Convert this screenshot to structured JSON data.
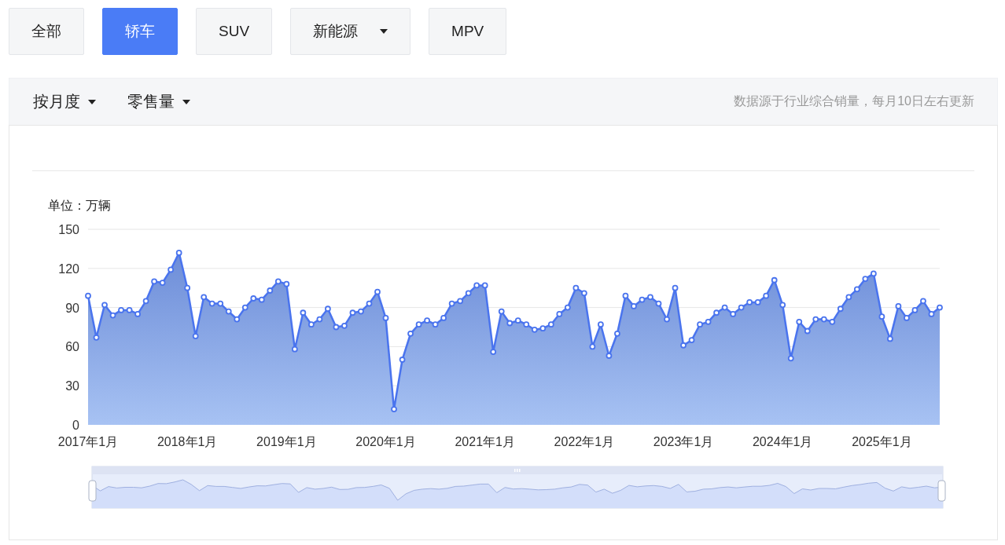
{
  "tabs": [
    {
      "label": "全部",
      "selected": false,
      "has_menu": false
    },
    {
      "label": "轿车",
      "selected": true,
      "has_menu": false
    },
    {
      "label": "SUV",
      "selected": false,
      "has_menu": false
    },
    {
      "label": "新能源",
      "selected": false,
      "has_menu": true
    },
    {
      "label": "MPV",
      "selected": false,
      "has_menu": false
    }
  ],
  "toolbar": {
    "period": "按月度",
    "metric": "零售量",
    "note": "数据源于行业综合销量，每月10日左右更新"
  },
  "chart": {
    "chart_data": {
      "type": "area",
      "ylabel": "单位：万辆",
      "ylim": [
        0,
        150
      ],
      "grid": true,
      "yticks": [
        0,
        30,
        60,
        90,
        120,
        150
      ],
      "categories": [
        "2017年1月",
        null,
        null,
        null,
        null,
        null,
        null,
        null,
        null,
        null,
        null,
        null,
        "2018年1月",
        null,
        null,
        null,
        null,
        null,
        null,
        null,
        null,
        null,
        null,
        null,
        "2019年1月",
        null,
        null,
        null,
        null,
        null,
        null,
        null,
        null,
        null,
        null,
        null,
        "2020年1月",
        null,
        null,
        null,
        null,
        null,
        null,
        null,
        null,
        null,
        null,
        null,
        "2021年1月",
        null,
        null,
        null,
        null,
        null,
        null,
        null,
        null,
        null,
        null,
        null,
        "2022年1月",
        null,
        null,
        null,
        null,
        null,
        null,
        null,
        null,
        null,
        null,
        null,
        "2023年1月",
        null,
        null,
        null,
        null,
        null,
        null,
        null,
        null,
        null,
        null,
        null,
        "2024年1月",
        null,
        null,
        null,
        null,
        null,
        null,
        null,
        null,
        null,
        null,
        null,
        "2025年1月",
        null,
        null,
        null,
        null,
        null,
        null,
        null
      ],
      "series": [
        {
          "color": "#4a74ee",
          "values": [
            99,
            67,
            92,
            84,
            88,
            88,
            85,
            95,
            110,
            109,
            119,
            132,
            105,
            68,
            98,
            93,
            93,
            87,
            81,
            90,
            97,
            96,
            103,
            110,
            108,
            58,
            86,
            77,
            81,
            89,
            75,
            76,
            86,
            87,
            93,
            102,
            82,
            12,
            50,
            70,
            77,
            80,
            77,
            82,
            93,
            95,
            101,
            107,
            107,
            56,
            87,
            78,
            80,
            77,
            73,
            74,
            77,
            85,
            90,
            105,
            101,
            60,
            77,
            53,
            70,
            99,
            91,
            96,
            98,
            93,
            81,
            105,
            61,
            65,
            77,
            79,
            86,
            90,
            85,
            90,
            94,
            94,
            99,
            111,
            92,
            51,
            79,
            72,
            81,
            81,
            79,
            89,
            98,
            104,
            112,
            116,
            83,
            66,
            91,
            82,
            88,
            95,
            85,
            90
          ]
        }
      ]
    }
  }
}
